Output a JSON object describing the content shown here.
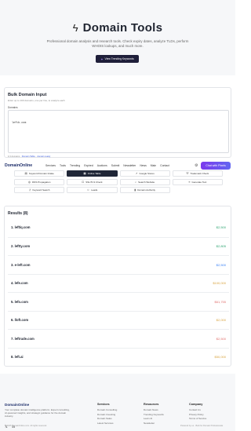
{
  "hero": {
    "title": "Domain Tools",
    "icon": "lightning-bolt-icon",
    "subtitle": "Professional domain analysis and research tools. Check expiry dates, analyze TLDs, perform WHOIS lookups, and much more.",
    "button_label": "View Trending Keywords"
  },
  "bulk": {
    "title": "Bulk Domain Input",
    "subtitle": "Enter up to 100 domains, one per line, to analyze each",
    "label": "Domains",
    "value": "leftb.com",
    "footer_prefix": "1/1 domains · ",
    "footer_link": "Domain Table · domain ready"
  },
  "nav": {
    "brand": "DomainOnline",
    "items": [
      "Services",
      "Tools",
      "Trending",
      "Expired",
      "Auctions",
      "Submit",
      "Newsletter",
      "News",
      "Main",
      "Contact"
    ],
    "chat_label": "Chat with Pixels"
  },
  "tools": [
    {
      "label": "Keyword Domain Intake",
      "icon": "document-icon",
      "active": false
    },
    {
      "label": "Online Table",
      "icon": "table-icon",
      "active": true
    },
    {
      "label": "Google Stores",
      "icon": "trend-icon",
      "active": false
    },
    {
      "label": "Trademark Check",
      "icon": "shield-icon",
      "active": false
    },
    {
      "label": "DNS Propagation",
      "icon": "globe-icon",
      "active": false
    },
    {
      "label": "SSL/TLS Check",
      "icon": "lock-icon",
      "active": false
    },
    {
      "label": "Search Website",
      "icon": "search-icon",
      "active": false
    },
    {
      "label": "Generate Text",
      "icon": "text-icon",
      "active": false
    },
    {
      "label": "Keyword Search",
      "icon": "key-icon",
      "active": false
    },
    {
      "label": "Leads",
      "icon": "user-icon",
      "active": false
    },
    {
      "label": "Domain Authority",
      "icon": "chart-icon",
      "active": false
    }
  ],
  "results": {
    "title": "Results (8)",
    "rows": [
      {
        "name": "1. leftlq.com",
        "price": "$2,500",
        "color": "#2fa572"
      },
      {
        "name": "2. leftty.com",
        "price": "$2,805",
        "color": "#2fa572"
      },
      {
        "name": "3. e-left.com",
        "price": "$2,500",
        "color": "#3b82f6"
      },
      {
        "name": "4. lefe.com",
        "price": "$100,000",
        "color": "#d9a441"
      },
      {
        "name": "5. lefo.com",
        "price": "$61,755",
        "color": "#e0706d"
      },
      {
        "name": "6. lloft.com",
        "price": "$2,000",
        "color": "#d9a441"
      },
      {
        "name": "7. leftrude.com",
        "price": "$2,500",
        "color": "#e0706d"
      },
      {
        "name": "8. left.ai",
        "price": "$50,000",
        "color": "#d9a441"
      }
    ]
  },
  "footer": {
    "brand": "DomainOnline",
    "description": "Your complete domain intelligence platform. Expert consulting, AI-powered insights, and strategic guidance for the domain industry.",
    "columns": [
      {
        "title": "Services",
        "links": [
          "Domain Consulting",
          "Domain Investing",
          "Domain Sales",
          "Latest Services"
        ]
      },
      {
        "title": "Resources",
        "links": [
          "Domain News",
          "Trending Keywords",
          "Learn AI",
          "Newsletter"
        ]
      },
      {
        "title": "Company",
        "links": [
          "Contact Us",
          "Privacy Policy",
          "Terms of Service"
        ]
      }
    ],
    "copyright": "© 2025 DomainOnline.com. All rights reserved.",
    "powered": "Powered by us · Built for Domain Professionals"
  }
}
